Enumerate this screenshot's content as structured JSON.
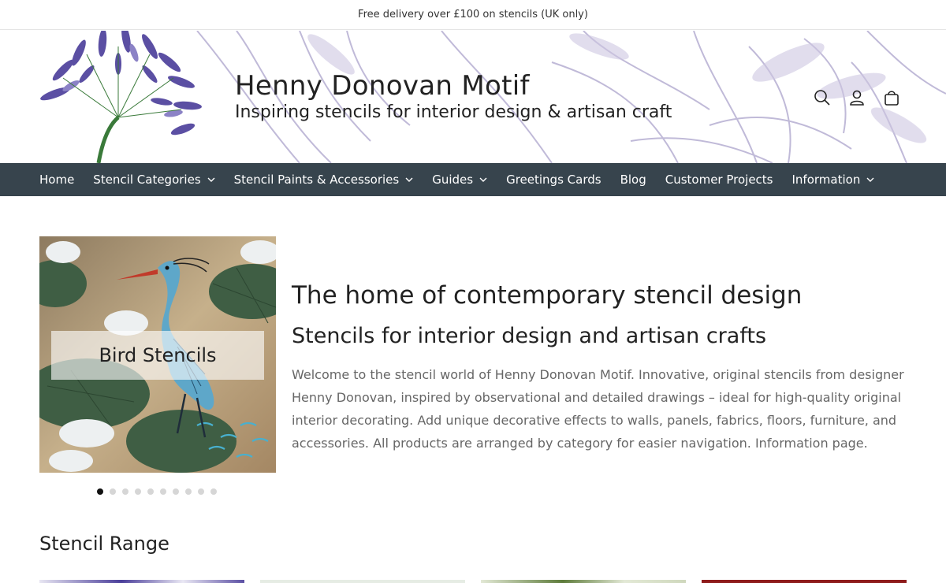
{
  "announcement": "Free delivery over £100 on stencils (UK only)",
  "brand": {
    "title": "Henny Donovan Motif",
    "subtitle": "Inspiring stencils for interior design & artisan craft"
  },
  "header_icons": [
    "search-icon",
    "account-icon",
    "cart-icon"
  ],
  "nav": [
    {
      "label": "Home",
      "dropdown": false
    },
    {
      "label": "Stencil Categories",
      "dropdown": true
    },
    {
      "label": "Stencil Paints & Accessories",
      "dropdown": true
    },
    {
      "label": "Guides",
      "dropdown": true
    },
    {
      "label": "Greetings Cards",
      "dropdown": false
    },
    {
      "label": "Blog",
      "dropdown": false
    },
    {
      "label": "Customer Projects",
      "dropdown": false
    },
    {
      "label": "Information",
      "dropdown": true
    }
  ],
  "slideshow": {
    "caption": "Bird Stencils",
    "slide_count": 10,
    "active_index": 0
  },
  "intro": {
    "heading": "The home of contemporary stencil design",
    "subheading": "Stencils for interior design and artisan crafts",
    "body": "Welcome to the stencil world of Henny Donovan Motif. Innovative, original stencils from designer Henny Donovan, inspired by observational and detailed drawings – ideal for high-quality original interior decorating. Add unique decorative effects to walls, panels, fabrics, floors, furniture, and accessories. All products are arranged by category for easier navigation. Information page."
  },
  "stencil_range": {
    "title": "Stencil Range"
  },
  "colors": {
    "nav_bg": "#37444d",
    "accent_purple": "#5b4fa3",
    "sketch_lilac": "#b6aed2",
    "text_muted": "#666666"
  }
}
